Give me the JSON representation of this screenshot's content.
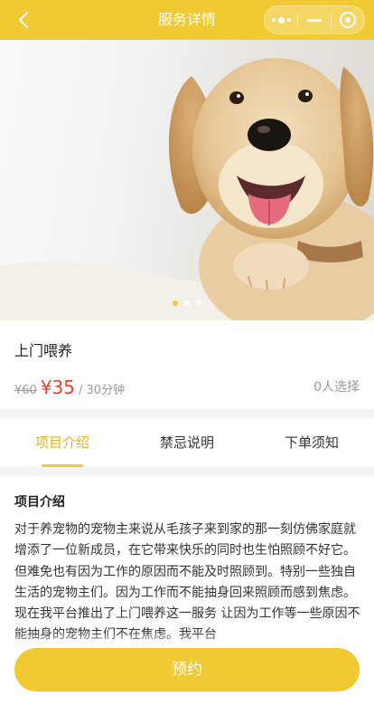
{
  "navbar": {
    "title": "服务详情",
    "background": "#f1c932",
    "back_icon": "chevron-left-icon",
    "capsule_icons": [
      "more-dots-icon",
      "minimize-icon",
      "close-target-icon"
    ]
  },
  "banner": {
    "image": "golden-retriever-puppy-photo",
    "slide_count": 3,
    "active_slide": 1,
    "indicator_color": "#f1c932"
  },
  "service": {
    "name": "上门喂养",
    "original_price": "¥60",
    "price": "¥35",
    "unit": "/ 30分钟",
    "selected_count": "0人选择",
    "price_color": "#e8432a"
  },
  "tabs": {
    "items": [
      "项目介绍",
      "禁忌说明",
      "下单须知"
    ],
    "active_index": 0,
    "active_color": "#e6b422"
  },
  "content": {
    "title": "项目介绍",
    "body": "对于养宠物的宠物主来说从毛孩子来到家的那一刻仿佛家庭就增添了一位新成员，在它带来快乐的同时也生怕照顾不好它。但难免也有因为工作的原因而不能及时照顾到。特别一些独自生活的宠物主们。因为工作而不能抽身回来照顾而感到焦虑。现在我平台推出了上门喂养这一服务 让因为工作等一些原因不能抽身的宠物主们不在焦虑。我平台"
  },
  "footer": {
    "book_label": "预约"
  }
}
